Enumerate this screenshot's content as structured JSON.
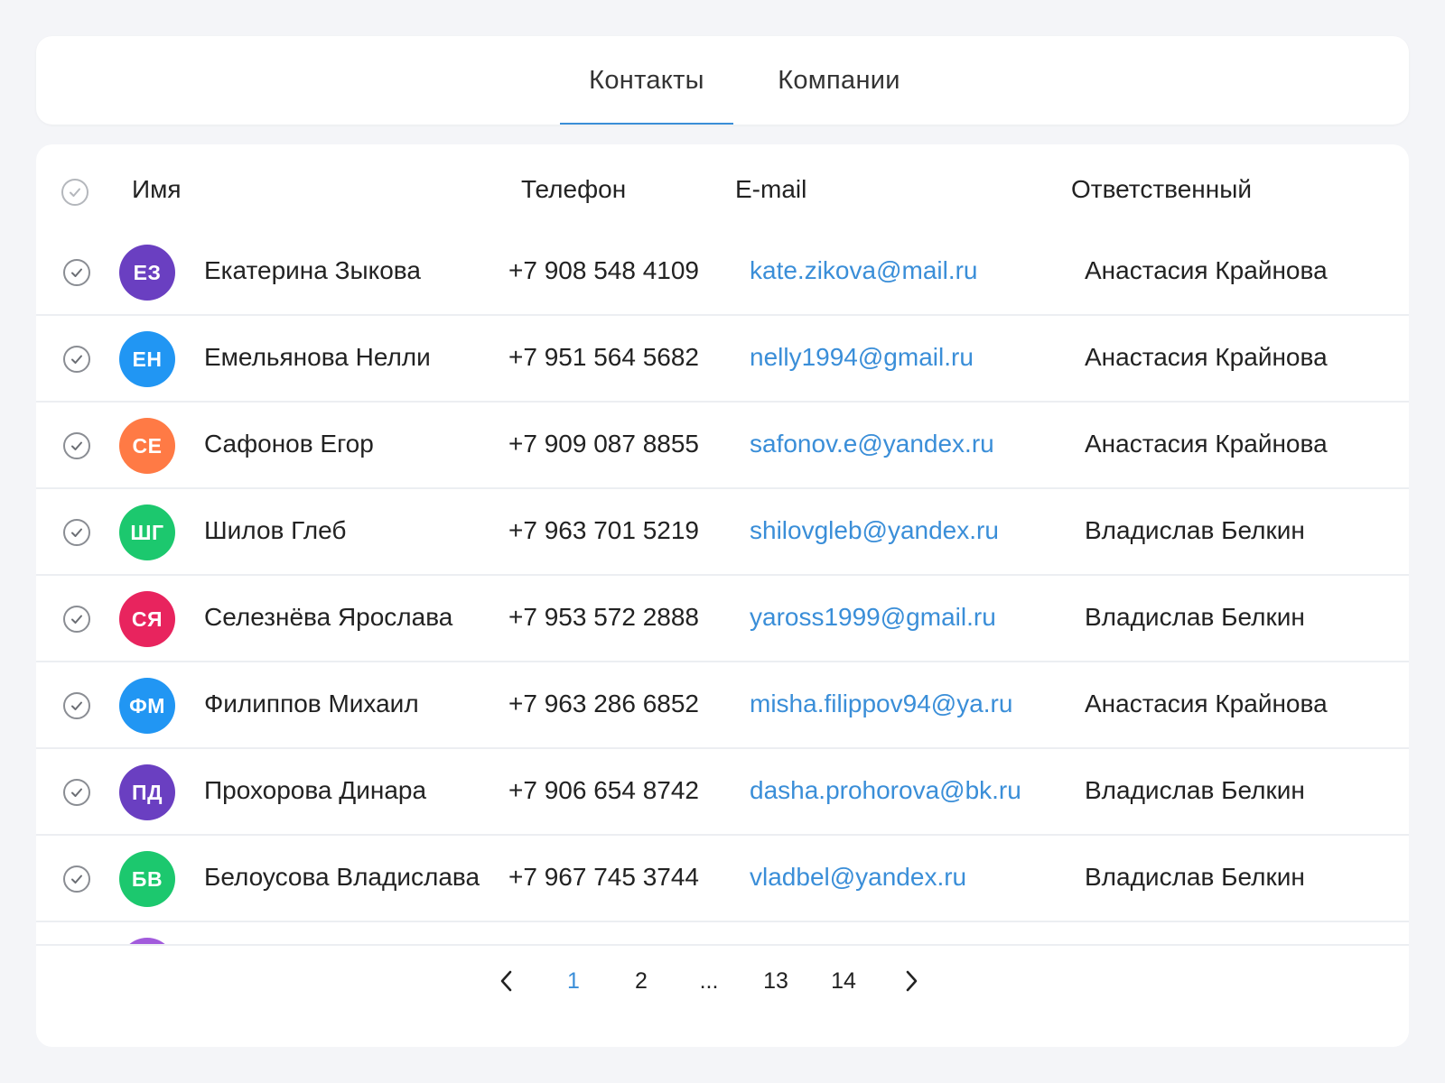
{
  "tabs": [
    {
      "label": "Контакты",
      "active": true
    },
    {
      "label": "Компании",
      "active": false
    }
  ],
  "table": {
    "columns": {
      "name": "Имя",
      "phone": "Телефон",
      "email": "E-mail",
      "owner": "Ответственный"
    },
    "rows": [
      {
        "initials": "ЕЗ",
        "color": "#6a3fc1",
        "name": "Екатерина Зыкова",
        "phone": "+7 908 548 4109",
        "email": "kate.zikova@mail.ru",
        "owner": "Анастасия Крайнова"
      },
      {
        "initials": "ЕН",
        "color": "#2196f3",
        "name": "Емельянова Нелли",
        "phone": "+7 951 564 5682",
        "email": "nelly1994@gmail.ru",
        "owner": "Анастасия Крайнова"
      },
      {
        "initials": "СЕ",
        "color": "#ff7a45",
        "name": "Сафонов Егор",
        "phone": "+7 909 087 8855",
        "email": "safonov.e@yandex.ru",
        "owner": "Анастасия Крайнова"
      },
      {
        "initials": "ШГ",
        "color": "#1cc86e",
        "name": "Шилов Глеб",
        "phone": "+7 963 701 5219",
        "email": "shilovgleb@yandex.ru",
        "owner": "Владислав Белкин"
      },
      {
        "initials": "СЯ",
        "color": "#e8245e",
        "name": "Селезнёва Ярослава",
        "phone": "+7 953 572 2888",
        "email": "yaross1999@gmail.ru",
        "owner": "Владислав Белкин"
      },
      {
        "initials": "ФМ",
        "color": "#2196f3",
        "name": "Филиппов Михаил",
        "phone": "+7 963 286 6852",
        "email": "misha.filippov94@ya.ru",
        "owner": "Анастасия Крайнова"
      },
      {
        "initials": "ПД",
        "color": "#6a3fc1",
        "name": "Прохорова Динара",
        "phone": "+7 906 654 8742",
        "email": "dasha.prohorova@bk.ru",
        "owner": "Владислав Белкин"
      },
      {
        "initials": "БВ",
        "color": "#1cc86e",
        "name": "Белоусова Владислава",
        "phone": "+7 967 745 3744",
        "email": "vladbel@yandex.ru",
        "owner": "Владислав Белкин"
      }
    ],
    "partial_row_color": "#a25bdc"
  },
  "pagination": {
    "prev_icon": "chevron-left-icon",
    "next_icon": "chevron-right-icon",
    "pages": [
      "1",
      "2",
      "...",
      "13",
      "14"
    ],
    "current": "1"
  },
  "colors": {
    "accent": "#3a8ed8",
    "background": "#f4f5f8"
  }
}
